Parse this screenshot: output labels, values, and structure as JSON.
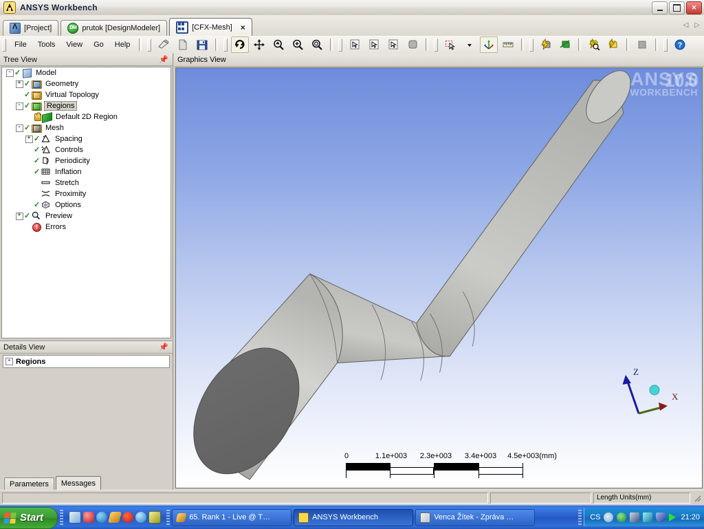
{
  "window": {
    "title": "ANSYS Workbench",
    "app_icon": "ansys-logo-icon",
    "minimize_label": "Minimize",
    "restore_label": "Restore",
    "close_label": "Close"
  },
  "tabs": {
    "items": [
      {
        "label": "[Project]",
        "icon": "project-icon",
        "active": false,
        "closable": false
      },
      {
        "label": "prutok [DesignModeler]",
        "icon": "designmodeler-icon",
        "active": false,
        "closable": false
      },
      {
        "label": "[CFX-Mesh]",
        "icon": "cfx-mesh-icon",
        "active": true,
        "closable": true,
        "close_label": "×"
      }
    ],
    "scroll_left": "◁",
    "scroll_right": "▷"
  },
  "menu": {
    "items": [
      "File",
      "Tools",
      "View",
      "Go",
      "Help"
    ]
  },
  "toolbar": {
    "groups": [
      [
        "new-icon",
        "open-icon",
        "save-icon"
      ],
      [
        "rotate-icon",
        "pan-icon",
        "zoom-box-icon",
        "zoom-in-icon",
        "zoom-to-fit-icon"
      ],
      [
        "select-vertex-icon",
        "select-edge-icon",
        "select-face-icon",
        "select-body-icon"
      ],
      [
        "box-select-icon",
        "select-mode-dropdown-icon",
        "coordinate-triad-icon",
        "ruler-measure-icon"
      ],
      [
        "generate-surface-mesh-icon",
        "generate-volume-mesh-icon",
        "preview-surface-mesh-icon",
        "preview-inflation-icon"
      ],
      [
        "stop-icon"
      ],
      [
        "help-icon"
      ]
    ]
  },
  "tree_panel": {
    "title": "Tree View",
    "pin_icon": "pin-icon",
    "items": [
      {
        "label": "Model",
        "indent": 0,
        "expander": "-",
        "check": "green",
        "icon": "model-icon",
        "selected": false
      },
      {
        "label": "Geometry",
        "indent": 1,
        "expander": "+",
        "check": "green",
        "icon": "geometry-icon",
        "selected": false
      },
      {
        "label": "Virtual Topology",
        "indent": 1,
        "expander": "",
        "check": "green",
        "icon": "virtual-topology-icon",
        "selected": false
      },
      {
        "label": "Regions",
        "indent": 1,
        "expander": "-",
        "check": "green",
        "icon": "regions-icon",
        "selected": true
      },
      {
        "label": "Default 2D Region",
        "indent": 2,
        "expander": "",
        "check": "lock",
        "icon": "default-2d-region-icon",
        "selected": false
      },
      {
        "label": "Mesh",
        "indent": 1,
        "expander": "-",
        "check": "green",
        "icon": "mesh-icon",
        "selected": false
      },
      {
        "label": "Spacing",
        "indent": 2,
        "expander": "+",
        "check": "green",
        "icon": "spacing-icon",
        "selected": false
      },
      {
        "label": "Controls",
        "indent": 2,
        "expander": "",
        "check": "green",
        "icon": "controls-icon",
        "selected": false
      },
      {
        "label": "Periodicity",
        "indent": 2,
        "expander": "",
        "check": "green",
        "icon": "periodicity-icon",
        "selected": false
      },
      {
        "label": "Inflation",
        "indent": 2,
        "expander": "",
        "check": "green",
        "icon": "inflation-icon",
        "selected": false
      },
      {
        "label": "Stretch",
        "indent": 2,
        "expander": "",
        "check": "none",
        "icon": "stretch-icon",
        "selected": false
      },
      {
        "label": "Proximity",
        "indent": 2,
        "expander": "",
        "check": "none",
        "icon": "proximity-icon",
        "selected": false
      },
      {
        "label": "Options",
        "indent": 2,
        "expander": "",
        "check": "green",
        "icon": "options-icon",
        "selected": false
      },
      {
        "label": "Preview",
        "indent": 1,
        "expander": "+",
        "check": "green",
        "icon": "preview-icon",
        "selected": false
      },
      {
        "label": "Errors",
        "indent": 1,
        "expander": "",
        "check": "none",
        "icon": "errors-icon",
        "selected": false
      }
    ]
  },
  "details_panel": {
    "title": "Details View",
    "pin_icon": "pin-icon",
    "expander": "-",
    "heading": "Regions"
  },
  "bottom_tabs": {
    "items": [
      {
        "label": "Parameters",
        "active": false
      },
      {
        "label": "Messages",
        "active": true
      }
    ]
  },
  "graphics": {
    "title": "Graphics View",
    "watermark_line1": "ANSYS",
    "watermark_line2": "WORKBENCH",
    "watermark_version": "10.0",
    "bg_top_color": "#6e8cdc",
    "bg_bottom_color": "#ffffff",
    "model_face_color": "#c8c8c4",
    "model_cap_color": "#666666",
    "scale_bar": {
      "ticks": [
        "0",
        "1.1e+003",
        "2.3e+003",
        "3.4e+003",
        "4.5e+003(mm)"
      ],
      "unit": "mm"
    },
    "triad": {
      "axes": [
        {
          "label": "Z",
          "color": "#1a1aa0"
        },
        {
          "label": "X",
          "color": "#8b1a1a"
        }
      ],
      "origin_marker": "y-axis-sphere"
    }
  },
  "statusbar": {
    "panes": [
      "",
      "",
      "Length Units(mm)"
    ]
  },
  "taskbar": {
    "start_label": "Start",
    "quicklaunch": [
      "show-desktop-icon",
      "outlook-express-icon",
      "media-player-icon",
      "internet-explorer-icon",
      "winamp-icon",
      "firefox-icon",
      "realplayer-icon",
      "icq-icon"
    ],
    "windows": [
      {
        "label": "65. Rank 1 - Live @ T…",
        "icon": "winamp-icon",
        "active": false
      },
      {
        "label": "ANSYS Workbench",
        "icon": "ansys-icon",
        "active": true
      },
      {
        "label": "Venca Žítek - Zpráva …",
        "icon": "outlook-icon",
        "active": false
      }
    ],
    "tray": {
      "language": "CS",
      "icons": [
        "volume-icon",
        "clover-icon",
        "network-icon",
        "bluetooth-icon",
        "shield-icon",
        "play-icon"
      ],
      "clock": "21:20"
    }
  }
}
